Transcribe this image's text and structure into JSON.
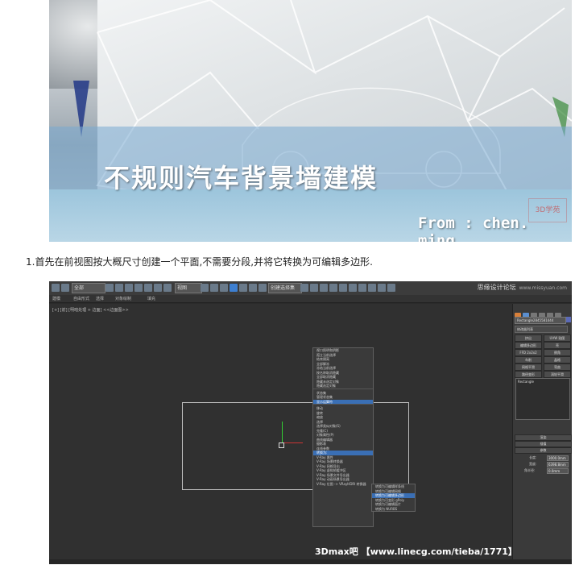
{
  "banner": {
    "title": "不规则汽车背景墙建模",
    "author": "From : chen. ming",
    "logo": "3D学苑"
  },
  "step_text": "1.首先在前视图按大概尺寸创建一个平面,不需要分段,并将它转换为可编辑多边形.",
  "max": {
    "toolbar": {
      "selection_filter": "全部",
      "view_select": "视图",
      "named_set": "创建选择集",
      "forum_name": "思缘设计论坛",
      "forum_url": "www.missyuan.com"
    },
    "ribbon_tabs": [
      "建模",
      "自由形式",
      "选择",
      "对象绘制",
      "填充"
    ],
    "viewport_label": "[+] [前] [明暗处理 + 边面] <<边面图>>",
    "quad_menu": [
      {
        "label": "视口照明和阴影"
      },
      {
        "label": "孤立当前选择"
      },
      {
        "label": "结束隔离"
      },
      {
        "label": "全部解冻"
      },
      {
        "label": "冻结当前选择"
      },
      {
        "label": "按名称取消隐藏"
      },
      {
        "label": "全部取消隐藏"
      },
      {
        "label": "隐藏未选定对象"
      },
      {
        "label": "隐藏选定对象"
      },
      {
        "label": "状态集"
      },
      {
        "label": "管理状态集"
      },
      {
        "label": "显示运算符"
      },
      {
        "label": "移动"
      },
      {
        "label": "旋转"
      },
      {
        "label": "缩放"
      },
      {
        "label": "选择"
      },
      {
        "label": "选择类似对象(S)"
      },
      {
        "label": "克隆(C)"
      },
      {
        "label": "对象属性(P)"
      },
      {
        "label": "曲线编辑器"
      },
      {
        "label": "摄影表"
      },
      {
        "label": "连线参数"
      },
      {
        "label": "转换为:",
        "highlight": true
      },
      {
        "label": "V-Ray 属性"
      },
      {
        "label": "V-Ray 场景转换器"
      },
      {
        "label": "V-Ray 网格导出"
      },
      {
        "label": "V-Ray 虚拟帧缓冲区"
      },
      {
        "label": "V-Ray 场景文件导出器"
      },
      {
        "label": "V-Ray 动画场景导出器"
      },
      {
        "label": "V-Ray 位图 -> VRayHDRI 转换器"
      }
    ],
    "submenu": [
      {
        "label": "转换为可编辑样条线"
      },
      {
        "label": "转换为可编辑网格"
      },
      {
        "label": "转换为可编辑多边形",
        "highlight": true
      },
      {
        "label": "转换为可变形 gPoly"
      },
      {
        "label": "转换为可编辑面片"
      },
      {
        "label": "转换为 NURBS"
      }
    ],
    "command_panel": {
      "object_name": "Rectangle2845581444",
      "modifier_list": "修改器列表",
      "buttons": [
        "挤出",
        "UVW 贴图",
        "编辑多边形",
        "壳",
        "FFD 2x2x2",
        "倒角",
        "车削",
        "晶格",
        "网格平滑",
        "弯曲",
        "路径变形",
        "涡轮平滑"
      ],
      "stack_item": "Rectangle",
      "rollouts": [
        "渲染",
        "插值",
        "参数"
      ],
      "params": [
        {
          "label": "长度:",
          "value": "3000.0mm"
        },
        {
          "label": "宽度:",
          "value": "6398.8mm"
        },
        {
          "label": "角半径:",
          "value": "0.0mm"
        }
      ]
    },
    "watermark": "3Dmax吧 【www.linecg.com/tieba/1771】"
  }
}
